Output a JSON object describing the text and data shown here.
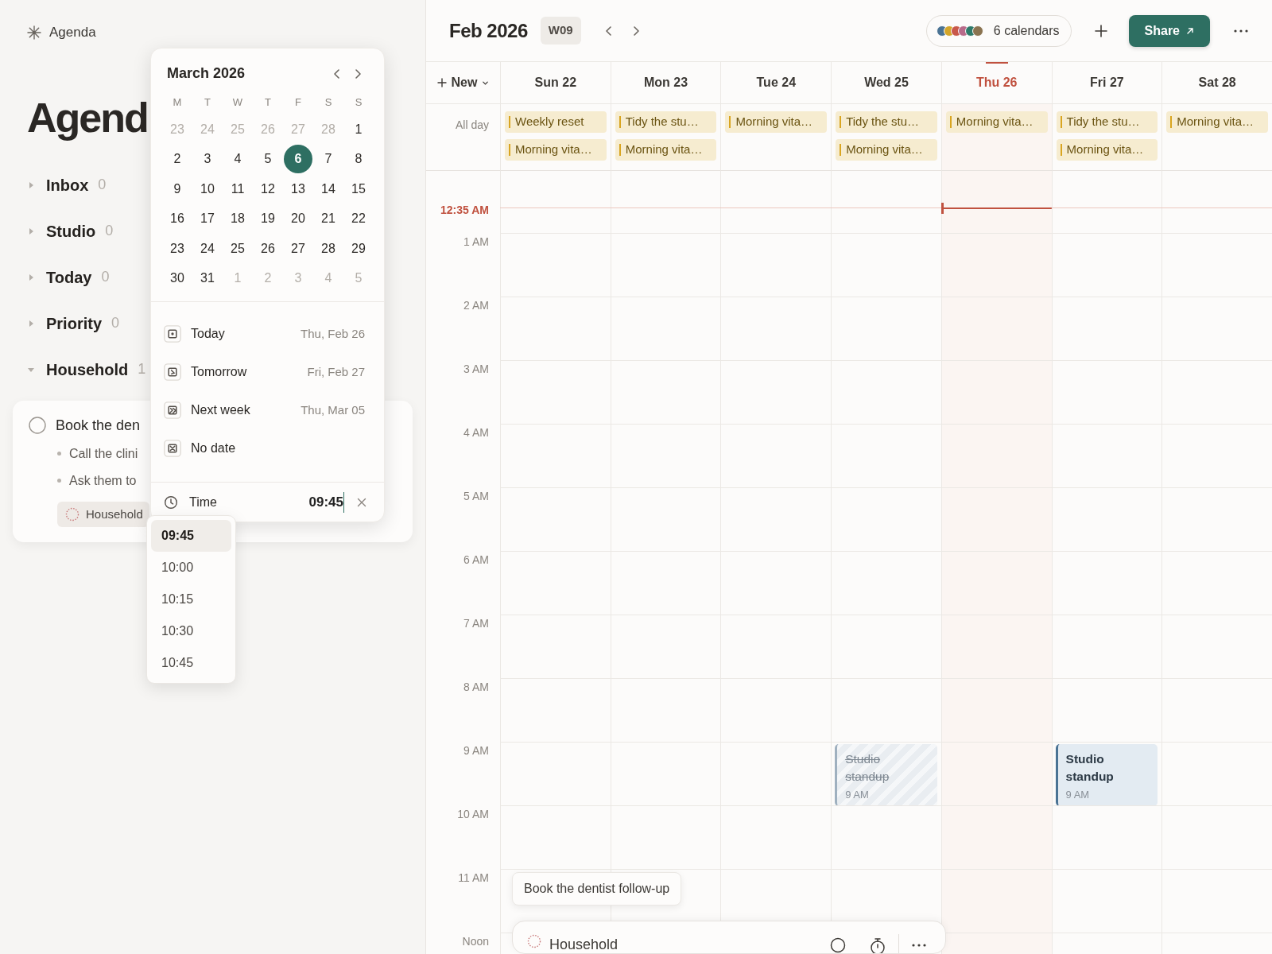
{
  "sidebar": {
    "app_title": "Agenda",
    "page_title": "Agend",
    "groups": [
      {
        "label": "Inbox",
        "count": "0",
        "expanded": false
      },
      {
        "label": "Studio",
        "count": "0",
        "expanded": false
      },
      {
        "label": "Today",
        "count": "0",
        "expanded": false
      },
      {
        "label": "Priority",
        "count": "0",
        "expanded": false
      },
      {
        "label": "Household",
        "count": "1",
        "expanded": true
      }
    ]
  },
  "task_card": {
    "title": "Book the den",
    "checked": false,
    "notes": [
      "Call the clini",
      "Ask them to"
    ],
    "tag": "Household"
  },
  "date_picker": {
    "month_title": "March 2026",
    "weekdays": [
      "M",
      "T",
      "W",
      "T",
      "F",
      "S",
      "S"
    ],
    "weeks": [
      [
        {
          "label": "23",
          "outside": true,
          "selected": false
        },
        {
          "label": "24",
          "outside": true,
          "selected": false
        },
        {
          "label": "25",
          "outside": true,
          "selected": false
        },
        {
          "label": "26",
          "outside": true,
          "selected": false
        },
        {
          "label": "27",
          "outside": true,
          "selected": false
        },
        {
          "label": "28",
          "outside": true,
          "selected": false
        },
        {
          "label": "1",
          "outside": false,
          "selected": false
        }
      ],
      [
        {
          "label": "2",
          "outside": false,
          "selected": false
        },
        {
          "label": "3",
          "outside": false,
          "selected": false
        },
        {
          "label": "4",
          "outside": false,
          "selected": false
        },
        {
          "label": "5",
          "outside": false,
          "selected": false
        },
        {
          "label": "6",
          "outside": false,
          "selected": true
        },
        {
          "label": "7",
          "outside": false,
          "selected": false
        },
        {
          "label": "8",
          "outside": false,
          "selected": false
        }
      ],
      [
        {
          "label": "9",
          "outside": false,
          "selected": false
        },
        {
          "label": "10",
          "outside": false,
          "selected": false
        },
        {
          "label": "11",
          "outside": false,
          "selected": false
        },
        {
          "label": "12",
          "outside": false,
          "selected": false
        },
        {
          "label": "13",
          "outside": false,
          "selected": false
        },
        {
          "label": "14",
          "outside": false,
          "selected": false
        },
        {
          "label": "15",
          "outside": false,
          "selected": false
        }
      ],
      [
        {
          "label": "16",
          "outside": false,
          "selected": false
        },
        {
          "label": "17",
          "outside": false,
          "selected": false
        },
        {
          "label": "18",
          "outside": false,
          "selected": false
        },
        {
          "label": "19",
          "outside": false,
          "selected": false
        },
        {
          "label": "20",
          "outside": false,
          "selected": false
        },
        {
          "label": "21",
          "outside": false,
          "selected": false
        },
        {
          "label": "22",
          "outside": false,
          "selected": false
        }
      ],
      [
        {
          "label": "23",
          "outside": false,
          "selected": false
        },
        {
          "label": "24",
          "outside": false,
          "selected": false
        },
        {
          "label": "25",
          "outside": false,
          "selected": false
        },
        {
          "label": "26",
          "outside": false,
          "selected": false
        },
        {
          "label": "27",
          "outside": false,
          "selected": false
        },
        {
          "label": "28",
          "outside": false,
          "selected": false
        },
        {
          "label": "29",
          "outside": false,
          "selected": false
        }
      ],
      [
        {
          "label": "30",
          "outside": false,
          "selected": false
        },
        {
          "label": "31",
          "outside": false,
          "selected": false
        },
        {
          "label": "1",
          "outside": true,
          "selected": false
        },
        {
          "label": "2",
          "outside": true,
          "selected": false
        },
        {
          "label": "3",
          "outside": true,
          "selected": false
        },
        {
          "label": "4",
          "outside": true,
          "selected": false
        },
        {
          "label": "5",
          "outside": true,
          "selected": false
        }
      ]
    ],
    "shortcuts": [
      {
        "kind": "today",
        "label": "Today",
        "date": "Thu, Feb 26"
      },
      {
        "kind": "tomorrow",
        "label": "Tomorrow",
        "date": "Fri, Feb 27"
      },
      {
        "kind": "next_week",
        "label": "Next week",
        "date": "Thu, Mar 05"
      },
      {
        "kind": "no_date",
        "label": "No date"
      }
    ],
    "time": {
      "label": "Time",
      "value": "09:45"
    }
  },
  "time_options": [
    {
      "label": "09:45",
      "selected": true
    },
    {
      "label": "10:00",
      "selected": false
    },
    {
      "label": "10:15",
      "selected": false
    },
    {
      "label": "10:30",
      "selected": false
    },
    {
      "label": "10:45",
      "selected": false
    }
  ],
  "calendar": {
    "title": "Feb 2026",
    "week": "W09",
    "calendars_label": "6 calendars",
    "calendar_dots": [
      {
        "color": "#4a7394"
      },
      {
        "color": "#d4a62a"
      },
      {
        "color": "#c9584a"
      },
      {
        "color": "#b86a8a"
      },
      {
        "color": "#2e7a6a"
      },
      {
        "color": "#8a7350"
      }
    ],
    "share": "Share",
    "new": "New",
    "all_day_label": "All day",
    "now_label": "12:35 AM",
    "days": [
      {
        "label": "Sun 22",
        "today": false,
        "all_day": [
          "Weekly reset",
          "Morning vita…"
        ]
      },
      {
        "label": "Mon 23",
        "today": false,
        "all_day": [
          "Tidy the stu…",
          "Morning vita…"
        ]
      },
      {
        "label": "Tue 24",
        "today": false,
        "all_day": [
          "Morning vita…"
        ]
      },
      {
        "label": "Wed 25",
        "today": false,
        "all_day": [
          "Tidy the stu…",
          "Morning vita…"
        ]
      },
      {
        "label": "Thu 26",
        "today": true,
        "all_day": [
          "Morning vita…"
        ]
      },
      {
        "label": "Fri 27",
        "today": false,
        "all_day": [
          "Tidy the stu…",
          "Morning vita…"
        ]
      },
      {
        "label": "Sat 28",
        "today": false,
        "all_day": [
          "Morning vita…"
        ]
      }
    ],
    "hours": [
      {
        "label": "1 AM"
      },
      {
        "label": "2 AM"
      },
      {
        "label": "3 AM"
      },
      {
        "label": "4 AM"
      },
      {
        "label": "5 AM"
      },
      {
        "label": "6 AM"
      },
      {
        "label": "7 AM"
      },
      {
        "label": "8 AM"
      },
      {
        "label": "9 AM",
        "cells": [
          {
            "kind": "empty"
          },
          {
            "kind": "empty"
          },
          {
            "kind": "empty"
          },
          {
            "kind": "event",
            "title": "Studio standup",
            "time": "9 AM",
            "done": true
          },
          {
            "kind": "empty"
          },
          {
            "kind": "event",
            "title": "Studio standup",
            "time": "9 AM",
            "done": false
          },
          {
            "kind": "empty"
          }
        ]
      },
      {
        "label": "10 AM"
      },
      {
        "label": "11 AM"
      },
      {
        "label": "Noon"
      }
    ],
    "drag_chip": "Book the dentist follow-up",
    "bottom_panel": {
      "title": "Household"
    }
  }
}
